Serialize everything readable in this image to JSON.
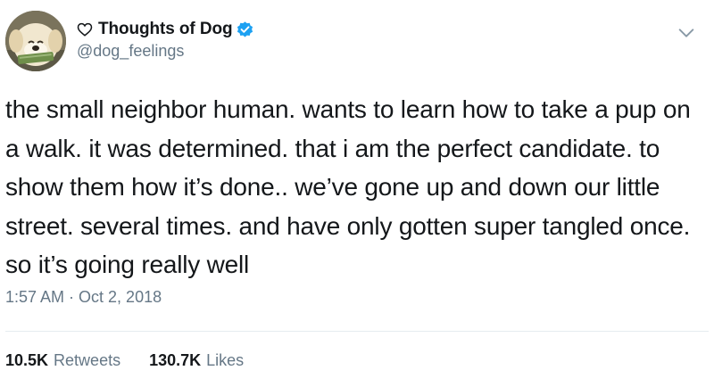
{
  "tweet": {
    "display_name": "Thoughts of Dog",
    "handle": "@dog_feelings",
    "text": "the small neighbor human. wants to learn how to take a pup on a walk. it was determined. that i am the perfect candidate. to show them how it’s done.. we’ve gone up and down our little street. several times. and have only gotten super tangled once. so it’s going really well",
    "timestamp": "1:57 AM · Oct 2, 2018",
    "retweets_count": "10.5K",
    "retweets_label": "Retweets",
    "likes_count": "130.7K",
    "likes_label": "Likes"
  },
  "icons": {
    "name_prefix": "heart-outline-icon",
    "verified": "verified-badge-icon",
    "menu": "chevron-down-icon"
  },
  "colors": {
    "text": "#14171a",
    "secondary": "#657786",
    "verified": "#1da1f2",
    "divider": "#e6ecf0"
  }
}
